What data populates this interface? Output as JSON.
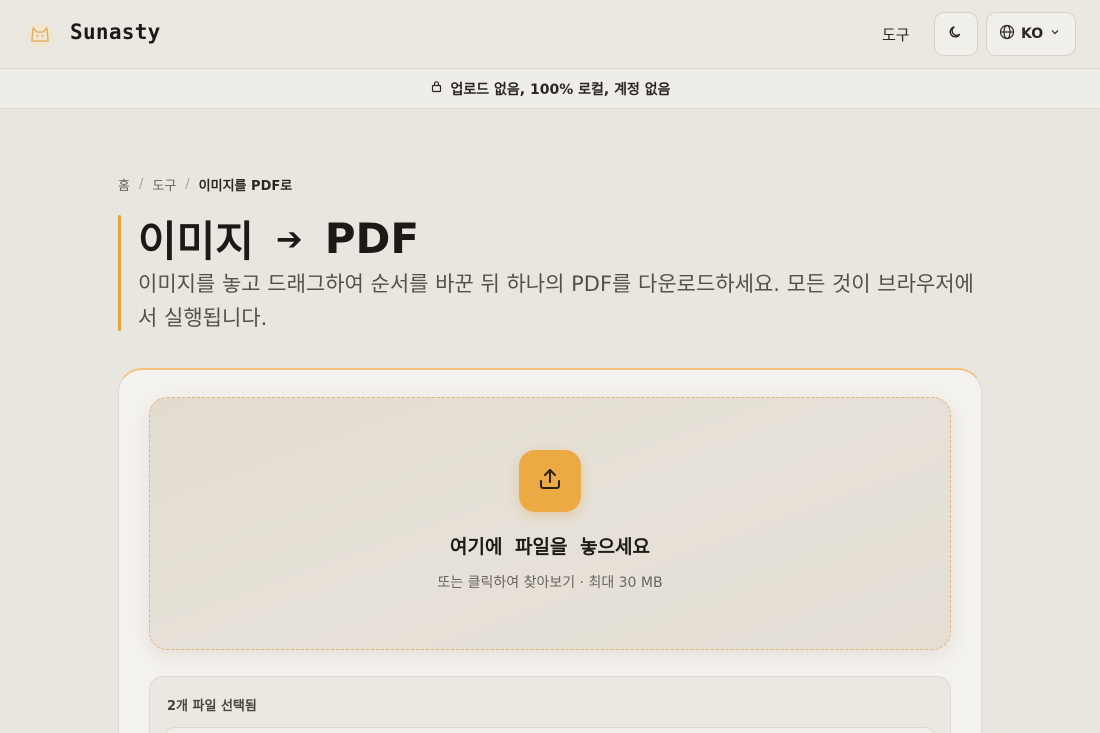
{
  "header": {
    "brand": "Sunasty",
    "logo_icon": "cat-icon",
    "nav_tools_label": "도구",
    "theme_icon": "moon-icon",
    "lang_label": "KO",
    "lang_icon": "globe-icon",
    "lang_chevron": "chevron-down-icon"
  },
  "banner": {
    "icon": "lock-icon",
    "text": "업로드 없음, 100% 로컬, 계정 없음"
  },
  "breadcrumb": {
    "items": [
      "홈",
      "도구",
      "이미지를 PDF로"
    ],
    "separator": "/"
  },
  "page": {
    "title_left": "이미지",
    "title_arrow": "➔",
    "title_right": "PDF",
    "subtitle": "이미지를 놓고 드래그하여 순서를 바꾼 뒤 하나의 PDF를 다운로드하세요. 모든 것이 브라우저에서 실행됩니다."
  },
  "dropzone": {
    "icon": "upload-icon",
    "title": "여기에 파일을 놓으세요",
    "hint": "또는 클릭하여 찾아보기 · 최대 30 MB"
  },
  "files": {
    "count_label": "2개 파일 선택됨"
  },
  "colors": {
    "accent": "#ecaa44",
    "background": "#e9e6e0"
  }
}
